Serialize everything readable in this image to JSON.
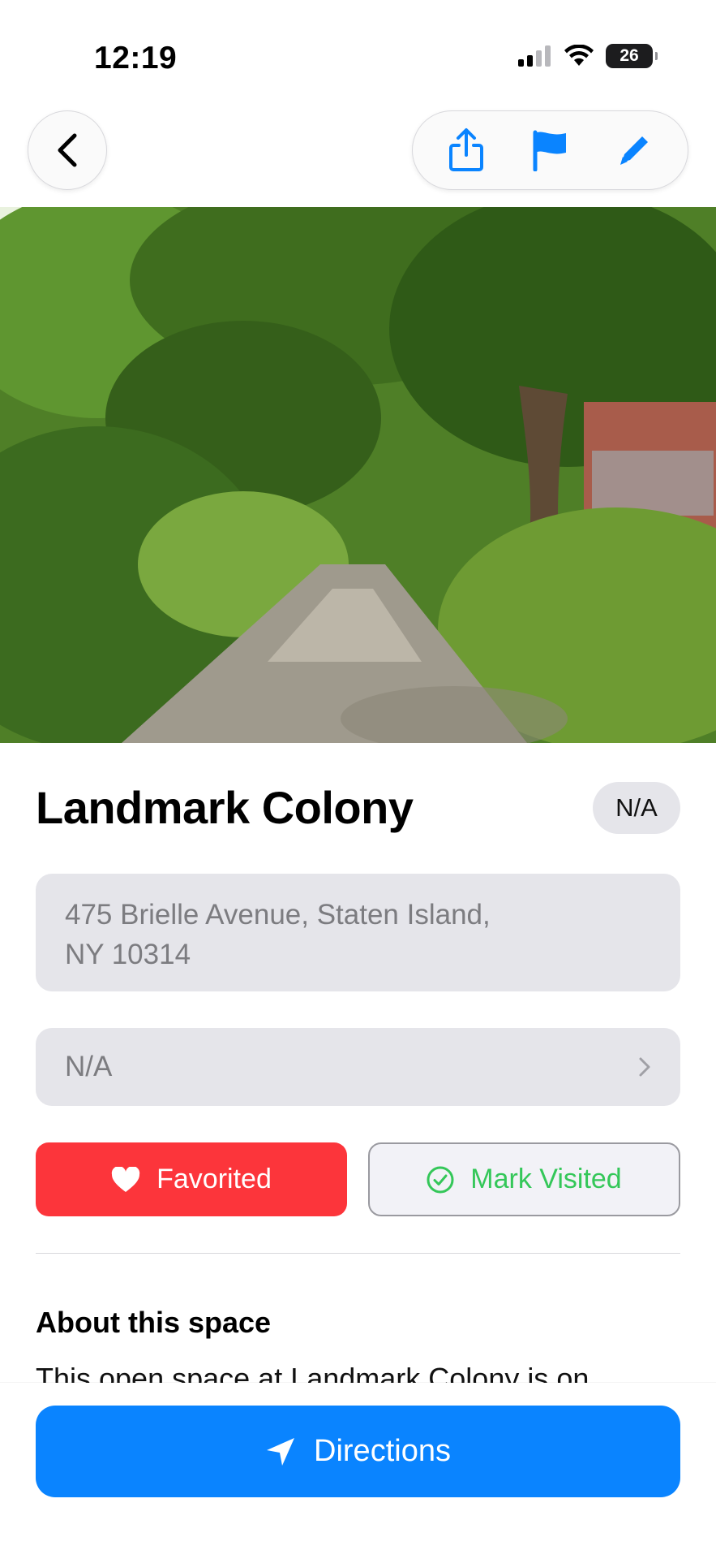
{
  "status_bar": {
    "time": "12:19",
    "battery": "26",
    "icons": [
      "signal-icon",
      "wifi-icon",
      "battery-icon"
    ]
  },
  "nav": {
    "back_icon": "chevron-left-icon",
    "actions": [
      "share-icon",
      "flag-icon",
      "pencil-icon"
    ],
    "accent_color": "#0a84ff"
  },
  "place": {
    "name": "Landmark Colony",
    "rating_badge": "N/A",
    "address": "475 Brielle Avenue, Staten Island,\nNY 10314",
    "category_value": "N/A"
  },
  "actions": {
    "favorite_label": "Favorited",
    "favorite_color": "#fc353b",
    "visited_label": "Mark Visited",
    "visited_color": "#34c759"
  },
  "about": {
    "heading": "About this space",
    "text": "This open space at Landmark Colony is on"
  },
  "footer": {
    "directions_label": "Directions",
    "directions_color": "#0a84ff"
  }
}
